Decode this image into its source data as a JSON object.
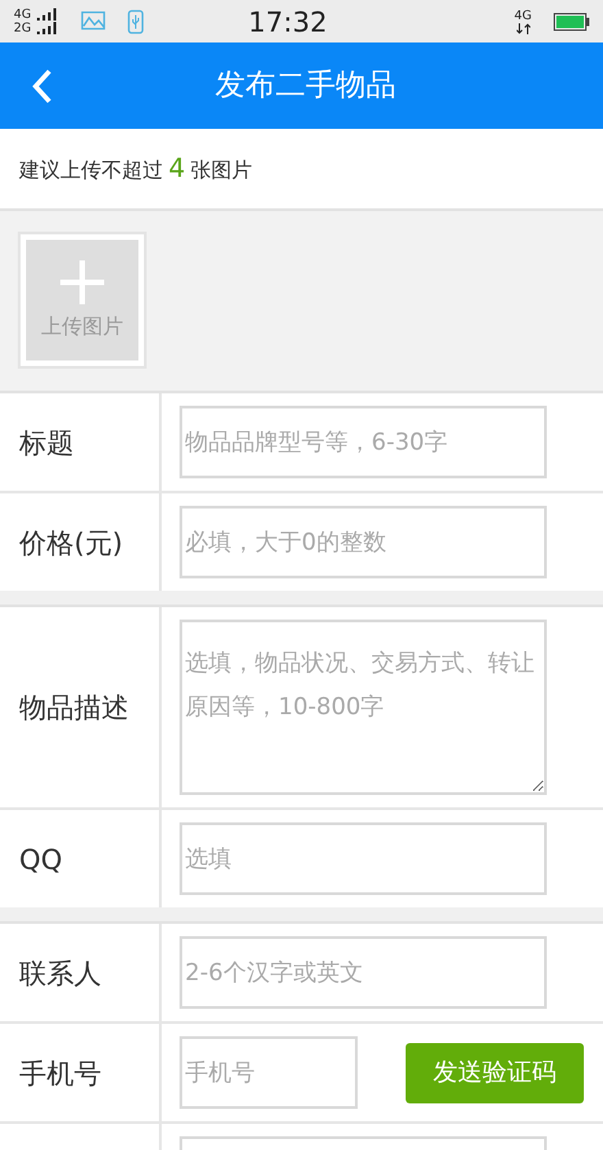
{
  "status_bar": {
    "sim_1": "4G",
    "sim_2": "2G",
    "time": "17:32",
    "network": "4G"
  },
  "header": {
    "title": "发布二手物品"
  },
  "notice": {
    "before": "建议上传不超过",
    "count": "4",
    "after": "张图片"
  },
  "upload": {
    "label": "上传图片"
  },
  "groups": [
    [
      {
        "kind": "input",
        "label": "标题",
        "placeholder": "物品品牌型号等，6-30字"
      },
      {
        "kind": "input",
        "label": "价格(元)",
        "placeholder": "必填，大于0的整数"
      }
    ],
    [
      {
        "kind": "textarea",
        "label": "物品描述",
        "placeholder": "选填，物品状况、交易方式、转让原因等，10-800字"
      },
      {
        "kind": "input",
        "label": "QQ",
        "placeholder": "选填"
      }
    ],
    [
      {
        "kind": "input",
        "label": "联系人",
        "placeholder": "2-6个汉字或英文"
      },
      {
        "kind": "phone",
        "label": "手机号",
        "placeholder": "手机号",
        "button": "发送验证码"
      },
      {
        "kind": "input"
      }
    ]
  ]
}
